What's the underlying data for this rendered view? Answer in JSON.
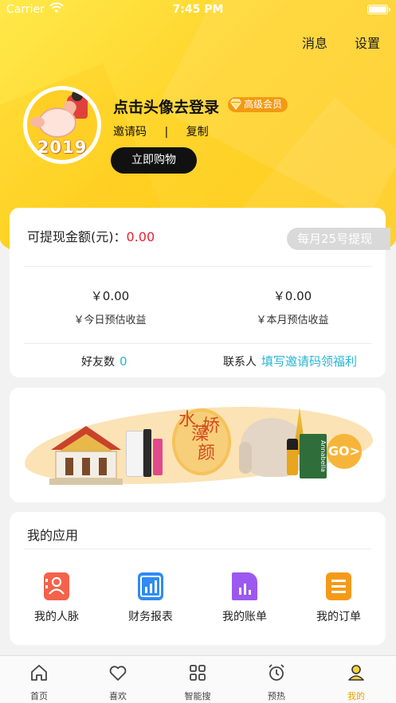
{
  "status_bar": {
    "carrier": "Carrier",
    "time": "7:45 PM"
  },
  "header": {
    "messages": "消息",
    "settings": "设置"
  },
  "profile": {
    "avatar_year": "2019",
    "login_prompt": "点击头像去登录",
    "vip_badge": "高级会员",
    "invite_code_label": "邀请码",
    "separator": "|",
    "copy_label": "复制",
    "buy_button": "立即购物"
  },
  "earnings": {
    "withdrawable_label": "可提现金额(元)：",
    "withdrawable_amount": "0.00",
    "withdraw_note": "每月25号提现",
    "today_value": "￥0.00",
    "today_label": "￥今日预估收益",
    "month_value": "￥0.00",
    "month_label": "￥本月预估收益",
    "friends_label": "好友数",
    "friends_count": "0",
    "contact_label": "联系人",
    "contact_link": "填写邀请码领福利"
  },
  "banner": {
    "chars": [
      "水",
      "藻",
      "娇",
      "颜"
    ],
    "go": "GO>",
    "brand": "Annabella"
  },
  "apps": {
    "title": "我的应用",
    "items": [
      {
        "label": "我的人脉",
        "icon": "contacts-icon",
        "color": "#f4624a"
      },
      {
        "label": "财务报表",
        "icon": "report-chart-icon",
        "color": "#2f8bf2"
      },
      {
        "label": "我的账单",
        "icon": "bill-icon",
        "color": "#9b59f0"
      },
      {
        "label": "我的订单",
        "icon": "order-list-icon",
        "color": "#f59a18"
      }
    ]
  },
  "tabbar": {
    "items": [
      {
        "label": "首页",
        "icon": "home-icon"
      },
      {
        "label": "喜欢",
        "icon": "heart-icon"
      },
      {
        "label": "智能搜",
        "icon": "grid-icon"
      },
      {
        "label": "预热",
        "icon": "alarm-clock-icon"
      },
      {
        "label": "我的",
        "icon": "person-icon",
        "active": true
      }
    ]
  },
  "colors": {
    "accent_yellow": "#ffd42b",
    "highlight_red": "#e8232f",
    "link_cyan": "#28b6d6",
    "active_tab": "#e6a300"
  }
}
